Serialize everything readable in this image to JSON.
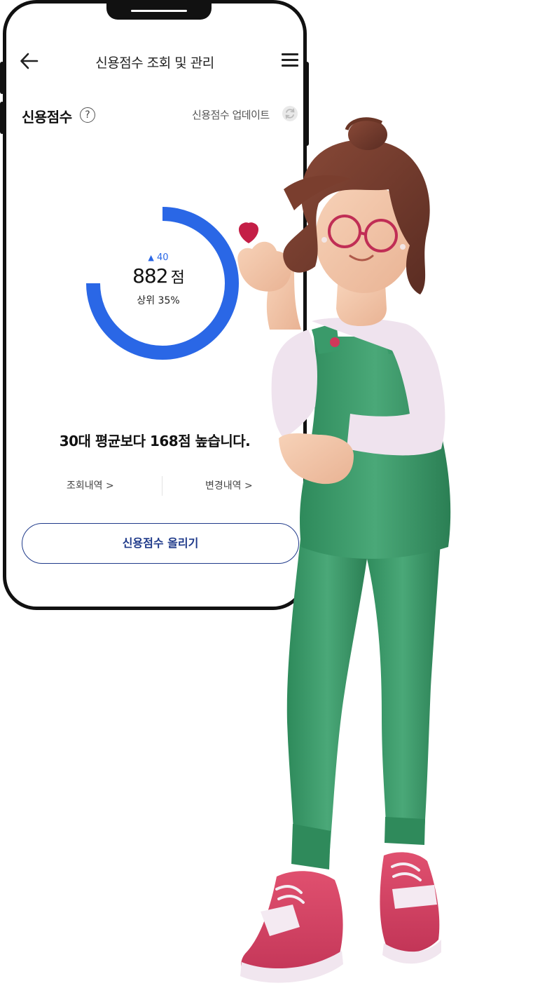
{
  "app": {
    "title": "신용점수 조회 및 관리"
  },
  "credit": {
    "section_title": "신용점수",
    "help_symbol": "?",
    "update_label": "신용점수 업데이트",
    "change_arrow": "▲",
    "change_value": "40",
    "score": "882",
    "score_unit": "점",
    "rank": "상위 35%",
    "gauge_fraction": 0.75,
    "gauge_color": "#2a67e6",
    "comparison": "30대 평균보다 168점 높습니다."
  },
  "links": {
    "history": "조회내역 >",
    "changes": "변경내역 >"
  },
  "cta": {
    "label": "신용점수 올리기",
    "color": "#1f3a8a"
  },
  "icons": {
    "back": "arrow-left",
    "menu": "hamburger",
    "help": "question-circle",
    "refresh": "refresh",
    "heart": "heart"
  }
}
